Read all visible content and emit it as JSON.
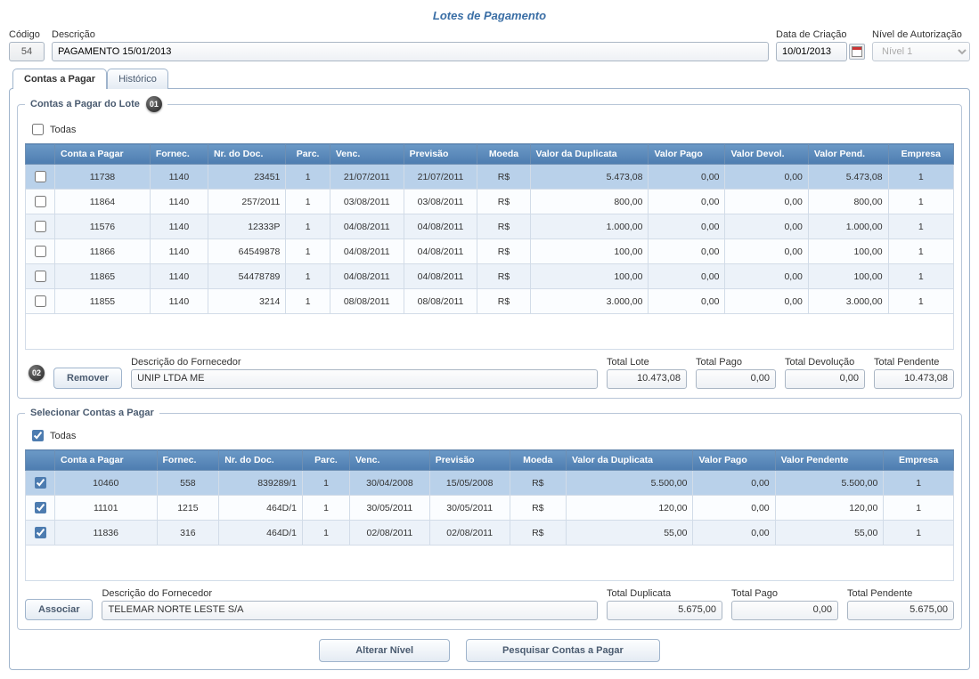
{
  "title": "Lotes de Pagamento",
  "labels": {
    "codigo": "Código",
    "descricao": "Descrição",
    "data_criacao": "Data de Criação",
    "nivel_autorizacao": "Nível de Autorização"
  },
  "values": {
    "codigo": "54",
    "descricao": "PAGAMENTO 15/01/2013",
    "data_criacao": "10/01/2013",
    "nivel": "Nível 1"
  },
  "tabs": {
    "contas": "Contas a Pagar",
    "historico": "Histórico"
  },
  "lote": {
    "legend": "Contas a Pagar do Lote",
    "badge": "01",
    "todas": "Todas",
    "columns": {
      "conta": "Conta a Pagar",
      "fornec": "Fornec.",
      "nrdoc": "Nr. do Doc.",
      "parc": "Parc.",
      "venc": "Venc.",
      "previsao": "Previsão",
      "moeda": "Moeda",
      "valor_dup": "Valor da Duplicata",
      "valor_pago": "Valor Pago",
      "valor_devol": "Valor Devol.",
      "valor_pend": "Valor Pend.",
      "empresa": "Empresa"
    },
    "rows": [
      {
        "sel": true,
        "conta": "11738",
        "fornec": "1140",
        "nrdoc": "23451",
        "parc": "1",
        "venc": "21/07/2011",
        "prev": "21/07/2011",
        "moeda": "R$",
        "dup": "5.473,08",
        "pago": "0,00",
        "devol": "0,00",
        "pend": "5.473,08",
        "emp": "1"
      },
      {
        "sel": false,
        "conta": "11864",
        "fornec": "1140",
        "nrdoc": "257/2011",
        "parc": "1",
        "venc": "03/08/2011",
        "prev": "03/08/2011",
        "moeda": "R$",
        "dup": "800,00",
        "pago": "0,00",
        "devol": "0,00",
        "pend": "800,00",
        "emp": "1"
      },
      {
        "sel": false,
        "conta": "11576",
        "fornec": "1140",
        "nrdoc": "12333P",
        "parc": "1",
        "venc": "04/08/2011",
        "prev": "04/08/2011",
        "moeda": "R$",
        "dup": "1.000,00",
        "pago": "0,00",
        "devol": "0,00",
        "pend": "1.000,00",
        "emp": "1"
      },
      {
        "sel": false,
        "conta": "11866",
        "fornec": "1140",
        "nrdoc": "64549878",
        "parc": "1",
        "venc": "04/08/2011",
        "prev": "04/08/2011",
        "moeda": "R$",
        "dup": "100,00",
        "pago": "0,00",
        "devol": "0,00",
        "pend": "100,00",
        "emp": "1"
      },
      {
        "sel": false,
        "conta": "11865",
        "fornec": "1140",
        "nrdoc": "54478789",
        "parc": "1",
        "venc": "04/08/2011",
        "prev": "04/08/2011",
        "moeda": "R$",
        "dup": "100,00",
        "pago": "0,00",
        "devol": "0,00",
        "pend": "100,00",
        "emp": "1"
      },
      {
        "sel": false,
        "conta": "11855",
        "fornec": "1140",
        "nrdoc": "3214",
        "parc": "1",
        "venc": "08/08/2011",
        "prev": "08/08/2011",
        "moeda": "R$",
        "dup": "3.000,00",
        "pago": "0,00",
        "devol": "0,00",
        "pend": "3.000,00",
        "emp": "1"
      }
    ],
    "bottom": {
      "badge": "02",
      "remover": "Remover",
      "desc_fornec_label": "Descrição do Fornecedor",
      "desc_fornec": "UNIP LTDA ME",
      "total_lote_label": "Total Lote",
      "total_lote": "10.473,08",
      "total_pago_label": "Total Pago",
      "total_pago": "0,00",
      "total_devol_label": "Total Devolução",
      "total_devol": "0,00",
      "total_pend_label": "Total Pendente",
      "total_pend": "10.473,08"
    }
  },
  "selecionar": {
    "legend": "Selecionar Contas a Pagar",
    "todas": "Todas",
    "columns": {
      "conta": "Conta a Pagar",
      "fornec": "Fornec.",
      "nrdoc": "Nr. do Doc.",
      "parc": "Parc.",
      "venc": "Venc.",
      "previsao": "Previsão",
      "moeda": "Moeda",
      "valor_dup": "Valor da Duplicata",
      "valor_pago": "Valor Pago",
      "valor_pend": "Valor Pendente",
      "empresa": "Empresa"
    },
    "rows": [
      {
        "sel": true,
        "conta": "10460",
        "fornec": "558",
        "nrdoc": "839289/1",
        "parc": "1",
        "venc": "30/04/2008",
        "prev": "15/05/2008",
        "moeda": "R$",
        "dup": "5.500,00",
        "pago": "0,00",
        "pend": "5.500,00",
        "emp": "1"
      },
      {
        "sel": false,
        "conta": "11101",
        "fornec": "1215",
        "nrdoc": "464D/1",
        "parc": "1",
        "venc": "30/05/2011",
        "prev": "30/05/2011",
        "moeda": "R$",
        "dup": "120,00",
        "pago": "0,00",
        "pend": "120,00",
        "emp": "1"
      },
      {
        "sel": false,
        "conta": "11836",
        "fornec": "316",
        "nrdoc": "464D/1",
        "parc": "1",
        "venc": "02/08/2011",
        "prev": "02/08/2011",
        "moeda": "R$",
        "dup": "55,00",
        "pago": "0,00",
        "pend": "55,00",
        "emp": "1"
      }
    ],
    "bottom": {
      "associar": "Associar",
      "desc_fornec_label": "Descrição do Fornecedor",
      "desc_fornec": "TELEMAR NORTE LESTE S/A",
      "total_dup_label": "Total Duplicata",
      "total_dup": "5.675,00",
      "total_pago_label": "Total Pago",
      "total_pago": "0,00",
      "total_pend_label": "Total Pendente",
      "total_pend": "5.675,00"
    }
  },
  "footer": {
    "alterar": "Alterar Nível",
    "pesquisar": "Pesquisar Contas a Pagar"
  }
}
